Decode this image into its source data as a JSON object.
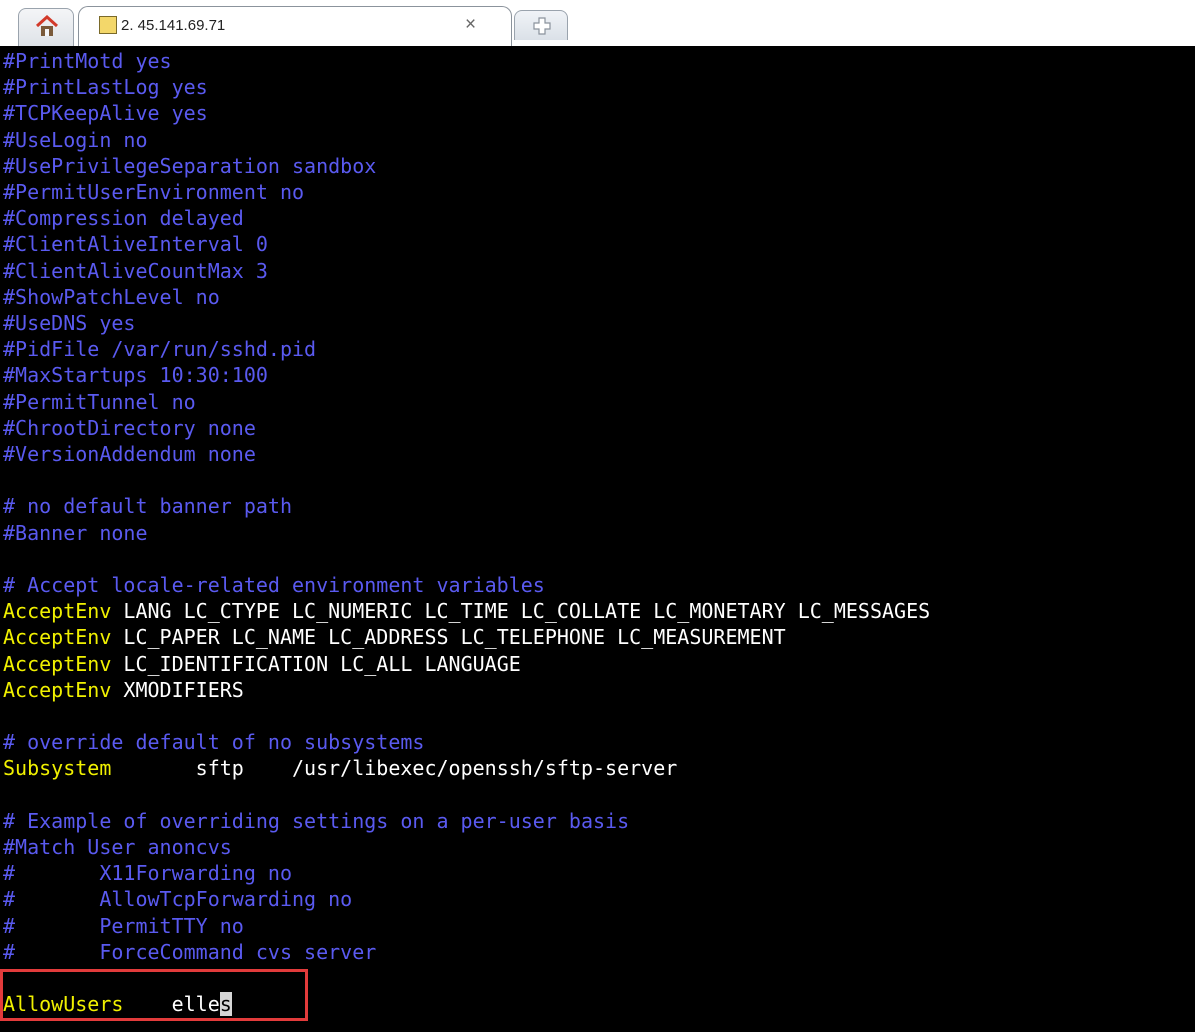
{
  "window": {
    "tab_title": "2. 45.141.69.71",
    "close_glyph": "×"
  },
  "icons": {
    "home": "home-icon",
    "session": "session-key-icon",
    "new_tab": "new-tab-icon"
  },
  "terminal": {
    "lines": [
      {
        "type": "comment",
        "text": "#PrintMotd yes"
      },
      {
        "type": "comment",
        "text": "#PrintLastLog yes"
      },
      {
        "type": "comment",
        "text": "#TCPKeepAlive yes"
      },
      {
        "type": "comment",
        "text": "#UseLogin no"
      },
      {
        "type": "comment",
        "text": "#UsePrivilegeSeparation sandbox"
      },
      {
        "type": "comment",
        "text": "#PermitUserEnvironment no"
      },
      {
        "type": "comment",
        "text": "#Compression delayed"
      },
      {
        "type": "comment",
        "text": "#ClientAliveInterval 0"
      },
      {
        "type": "comment",
        "text": "#ClientAliveCountMax 3"
      },
      {
        "type": "comment",
        "text": "#ShowPatchLevel no"
      },
      {
        "type": "comment",
        "text": "#UseDNS yes"
      },
      {
        "type": "comment",
        "text": "#PidFile /var/run/sshd.pid"
      },
      {
        "type": "comment",
        "text": "#MaxStartups 10:30:100"
      },
      {
        "type": "comment",
        "text": "#PermitTunnel no"
      },
      {
        "type": "comment",
        "text": "#ChrootDirectory none"
      },
      {
        "type": "comment",
        "text": "#VersionAddendum none"
      },
      {
        "type": "blank",
        "text": ""
      },
      {
        "type": "comment",
        "text": "# no default banner path"
      },
      {
        "type": "comment",
        "text": "#Banner none"
      },
      {
        "type": "blank",
        "text": ""
      },
      {
        "type": "comment",
        "text": "# Accept locale-related environment variables"
      },
      {
        "type": "directive",
        "keyword": "AcceptEnv",
        "value": " LANG LC_CTYPE LC_NUMERIC LC_TIME LC_COLLATE LC_MONETARY LC_MESSAGES"
      },
      {
        "type": "directive",
        "keyword": "AcceptEnv",
        "value": " LC_PAPER LC_NAME LC_ADDRESS LC_TELEPHONE LC_MEASUREMENT"
      },
      {
        "type": "directive",
        "keyword": "AcceptEnv",
        "value": " LC_IDENTIFICATION LC_ALL LANGUAGE"
      },
      {
        "type": "directive",
        "keyword": "AcceptEnv",
        "value": " XMODIFIERS"
      },
      {
        "type": "blank",
        "text": ""
      },
      {
        "type": "comment",
        "text": "# override default of no subsystems"
      },
      {
        "type": "directive",
        "keyword": "Subsystem",
        "value": "       sftp    /usr/libexec/openssh/sftp-server"
      },
      {
        "type": "blank",
        "text": ""
      },
      {
        "type": "comment",
        "text": "# Example of overriding settings on a per-user basis"
      },
      {
        "type": "comment",
        "text": "#Match User anoncvs"
      },
      {
        "type": "comment",
        "text": "#       X11Forwarding no"
      },
      {
        "type": "comment",
        "text": "#       AllowTcpForwarding no"
      },
      {
        "type": "comment",
        "text": "#       PermitTTY no"
      },
      {
        "type": "comment",
        "text": "#       ForceCommand cvs server"
      },
      {
        "type": "blank",
        "text": ""
      },
      {
        "type": "directive",
        "keyword": "AllowUsers",
        "value": "    elle",
        "cursor_char": "s"
      }
    ]
  },
  "colors": {
    "comment": "#5a5af0",
    "keyword": "#f0f000",
    "highlight_border": "#e23b3b"
  }
}
